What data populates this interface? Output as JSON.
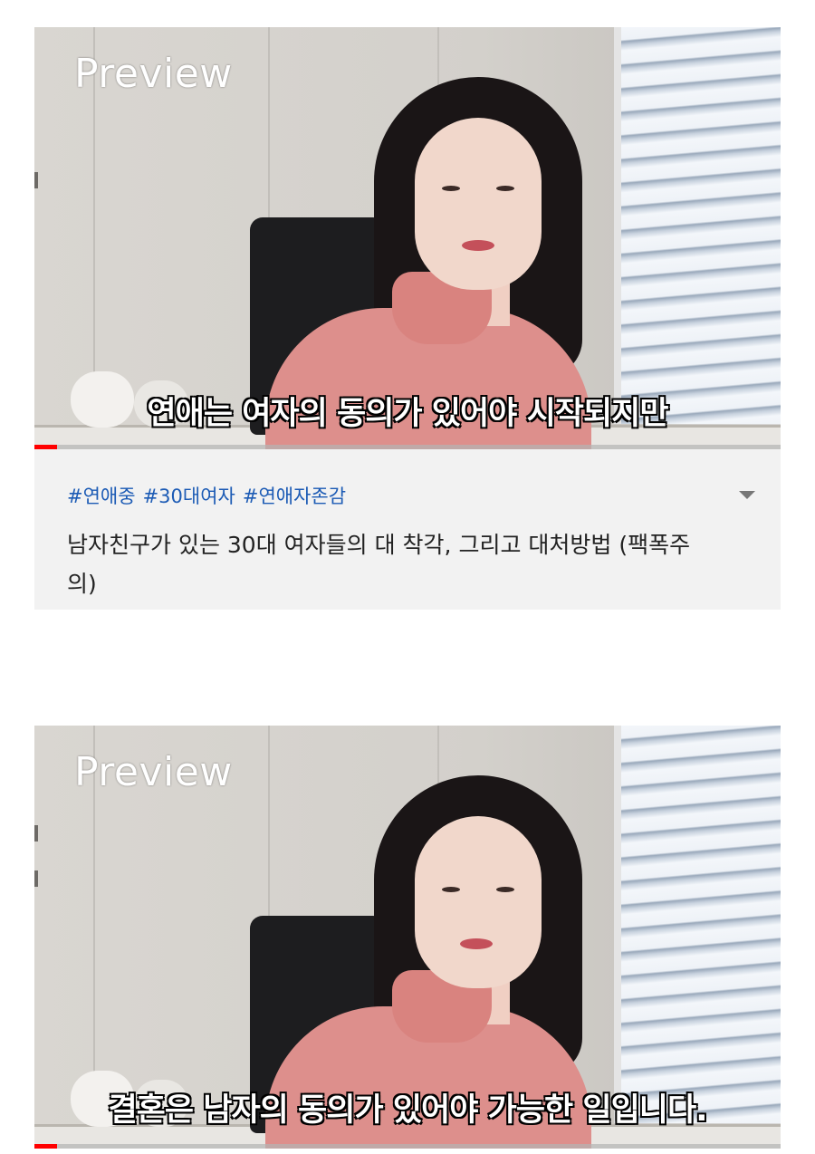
{
  "videos": [
    {
      "preview_label": "Preview",
      "subtitle": "연애는 여자의 동의가 있어야 시작되지만",
      "progress_fraction": 0.03
    },
    {
      "preview_label": "Preview",
      "subtitle": "결혼은 남자의 동의가 있어야 가능한 일입니다.",
      "progress_fraction": 0.03
    }
  ],
  "info": {
    "hashtags": [
      "#연애중",
      "#30대여자",
      "#연애자존감"
    ],
    "title": "남자친구가 있는 30대 여자들의  대 착각, 그리고 대처방법 (팩폭주의)"
  },
  "colors": {
    "hashtag": "#1c5bb5",
    "progress": "#ff0000",
    "info_background": "#f2f2f2"
  }
}
